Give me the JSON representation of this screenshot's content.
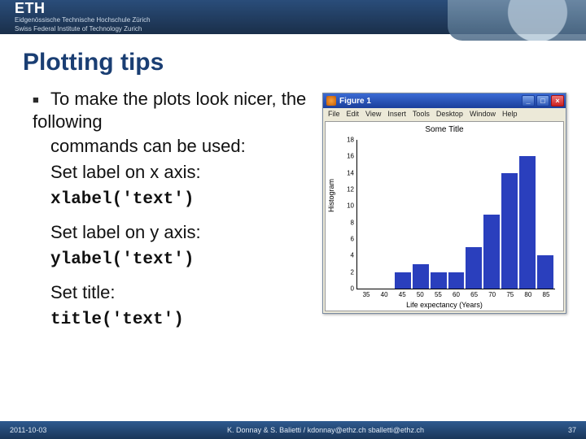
{
  "header": {
    "logo": "ETH",
    "sub1": "Eidgenössische Technische Hochschule Zürich",
    "sub2": "Swiss Federal Institute of Technology Zurich"
  },
  "title": "Plotting tips",
  "body": {
    "bullet": "To make the plots look nicer, the following",
    "line2": "commands can be used:",
    "xlbl": "Set label on x axis:",
    "xcmd": "xlabel('text')",
    "ylbl": "Set label on y axis:",
    "ycmd": "ylabel('text')",
    "tlbl": "Set title:",
    "tcmd": "title('text')"
  },
  "window": {
    "title": "Figure 1",
    "min": "_",
    "max": "□",
    "close": "×",
    "menu": [
      "File",
      "Edit",
      "View",
      "Insert",
      "Tools",
      "Desktop",
      "Window",
      "Help"
    ]
  },
  "chart_data": {
    "type": "bar",
    "title": "Some Title",
    "xlabel": "Life expectancy (Years)",
    "ylabel": "Histogram",
    "categories": [
      35,
      40,
      45,
      50,
      55,
      60,
      65,
      70,
      75,
      80,
      85
    ],
    "values": [
      0,
      0,
      2,
      3,
      2,
      2,
      5,
      9,
      14,
      16,
      4
    ],
    "ylim": [
      0,
      18
    ],
    "yticks": [
      0,
      2,
      4,
      6,
      8,
      10,
      12,
      14,
      16,
      18
    ]
  },
  "footer": {
    "date": "2011-10-03",
    "mid": "K. Donnay & S. Balietti / kdonnay@ethz.ch  sballetti@ethz.ch",
    "page": "37"
  }
}
